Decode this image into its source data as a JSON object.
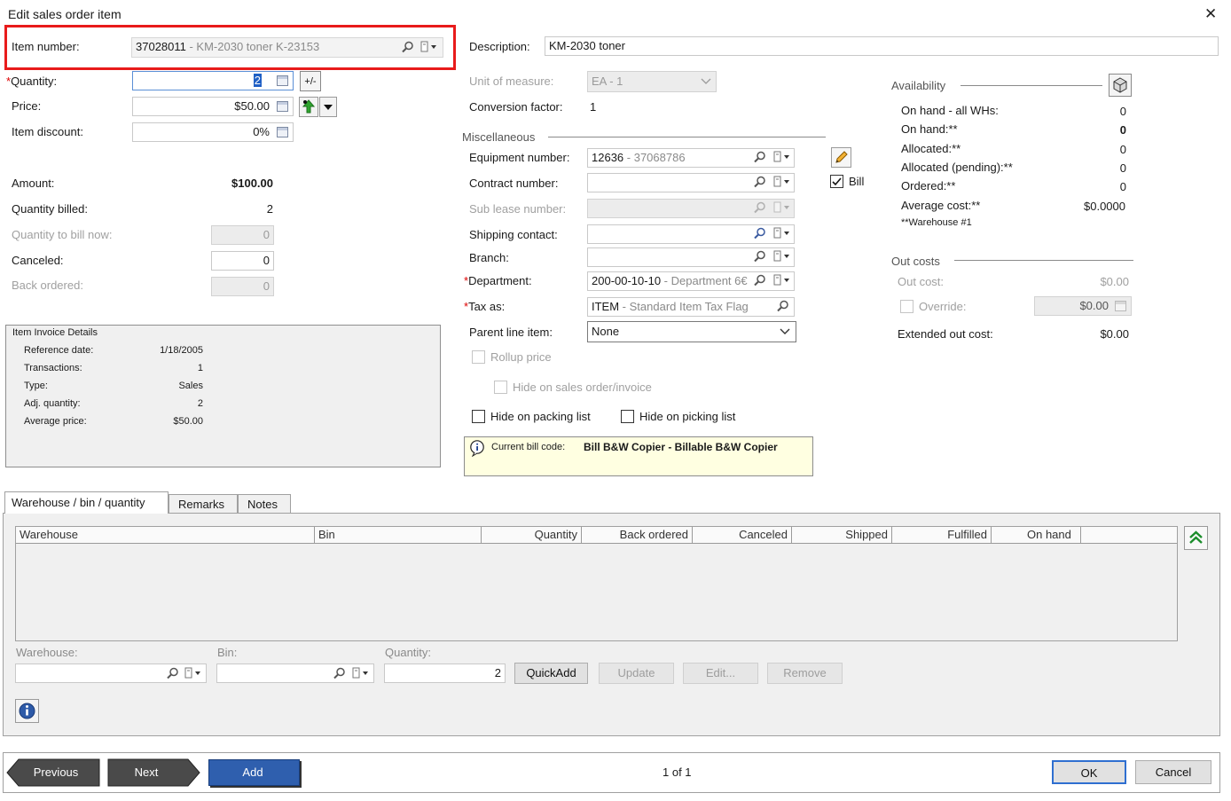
{
  "dialog": {
    "title": "Edit sales order item",
    "close_glyph": "✕"
  },
  "item": {
    "label": "Item number:",
    "number": "37028011",
    "desc": " - KM-2030 toner  K-23153"
  },
  "description": {
    "label": "Description:",
    "value": "KM-2030 toner"
  },
  "quantity": {
    "label": "Quantity:",
    "required": "*",
    "value": "2",
    "toggle_glyph": "+/-"
  },
  "price": {
    "label": "Price:",
    "value": "$50.00"
  },
  "discount": {
    "label": "Item discount:",
    "value": "0%"
  },
  "amount": {
    "label": "Amount:",
    "value": "$100.00"
  },
  "qty_billed": {
    "label": "Quantity billed:",
    "value": "2"
  },
  "qty_bill_now": {
    "label": "Quantity to bill now:",
    "value": "0"
  },
  "canceled": {
    "label": "Canceled:",
    "value": "0"
  },
  "back_ordered": {
    "label": "Back ordered:",
    "value": "0"
  },
  "invoice_details": {
    "title": "Item Invoice Details",
    "rows": [
      {
        "label": "Reference date:",
        "value": "1/18/2005"
      },
      {
        "label": "Transactions:",
        "value": "1"
      },
      {
        "label": "Type:",
        "value": "Sales"
      },
      {
        "label": "Adj. quantity:",
        "value": "2"
      },
      {
        "label": "Average price:",
        "value": "$50.00"
      }
    ]
  },
  "uom": {
    "label": "Unit of measure:",
    "value": "EA - 1"
  },
  "conversion": {
    "label": "Conversion factor:",
    "value": "1"
  },
  "misc": {
    "title": "Miscellaneous",
    "equipment": {
      "label": "Equipment number:",
      "value": "12636",
      "sub": " - 37068786"
    },
    "contract": {
      "label": "Contract number:",
      "value": ""
    },
    "sublease": {
      "label": "Sub lease number:",
      "value": ""
    },
    "shipping": {
      "label": "Shipping contact:",
      "value": ""
    },
    "branch": {
      "label": "Branch:",
      "value": ""
    },
    "department": {
      "label": "Department:",
      "required": "*",
      "value": "200-00-10-10",
      "sub": " - Department 6€"
    },
    "tax": {
      "label": "Tax as:",
      "required": "*",
      "value": "ITEM",
      "sub": " - Standard Item Tax Flag"
    },
    "parent": {
      "label": "Parent line item:",
      "value": "None"
    },
    "bill_label": "Bill"
  },
  "options": {
    "rollup": "Rollup price",
    "hide_sales": "Hide on sales order/invoice",
    "hide_packing": "Hide on packing list",
    "hide_picking": "Hide on picking list"
  },
  "bill_code": {
    "label": "Current bill code:",
    "value": "Bill B&W Copier - Billable B&W Copier"
  },
  "availability": {
    "title": "Availability",
    "rows": [
      {
        "label": "On hand - all WHs:",
        "value": "0",
        "bold": false
      },
      {
        "label": "On hand:**",
        "value": "0",
        "bold": true
      },
      {
        "label": "Allocated:**",
        "value": "0",
        "bold": false
      },
      {
        "label": "Allocated (pending):**",
        "value": "0",
        "bold": false
      },
      {
        "label": "Ordered:**",
        "value": "0",
        "bold": false
      },
      {
        "label": "Average cost:**",
        "value": "$0.0000",
        "bold": false
      }
    ],
    "note": "**Warehouse #1"
  },
  "out_costs": {
    "title": "Out costs",
    "out_cost": {
      "label": "Out cost:",
      "value": "$0.00"
    },
    "override": {
      "label": "Override:",
      "value": "$0.00"
    },
    "extended": {
      "label": "Extended out cost:",
      "value": "$0.00"
    }
  },
  "tabs": [
    "Warehouse / bin / quantity",
    "Remarks",
    "Notes"
  ],
  "grid": {
    "columns": [
      "Warehouse",
      "Bin",
      "Quantity",
      "Back ordered",
      "Canceled",
      "Shipped",
      "Fulfilled",
      "On hand"
    ]
  },
  "entry": {
    "warehouse_label": "Warehouse:",
    "bin_label": "Bin:",
    "quantity_label": "Quantity:",
    "quantity_value": "2",
    "buttons": [
      "QuickAdd",
      "Update",
      "Edit...",
      "Remove"
    ]
  },
  "footer": {
    "previous": "Previous",
    "next": "Next",
    "add": "Add",
    "page": "1 of 1",
    "ok": "OK",
    "cancel": "Cancel"
  },
  "colors": {
    "highlight_red": "#e81b1b",
    "bill_code_bg": "#ffffe1",
    "nav_dark": "#4a4a4a",
    "add_blue": "#2f5fae"
  }
}
